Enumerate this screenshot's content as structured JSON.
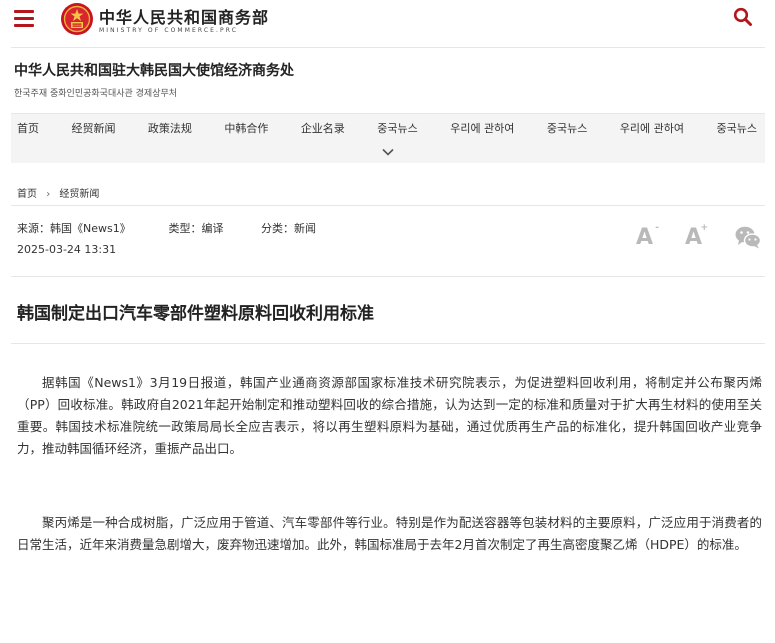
{
  "header": {
    "brand_cn": "中华人民共和国商务部",
    "brand_en": "MINISTRY OF COMMERCE.PRC",
    "accent_color": "#b3171c"
  },
  "org": {
    "name_cn": "中华人民共和国驻大韩民国大使馆经济商务处",
    "name_ko": "한국주재 중화인민공화국대사관 경제상무처"
  },
  "nav": {
    "items": [
      "首页",
      "经贸新闻",
      "政策法规",
      "中韩合作",
      "企业名录",
      "중국뉴스",
      "우리에 관하여",
      "중국뉴스",
      "우리에 관하여",
      "중국뉴스"
    ]
  },
  "breadcrumb": {
    "home": "首页",
    "separator": "›",
    "current": "经贸新闻"
  },
  "article": {
    "source": "来源：韩国《News1》",
    "type": "类型：编译",
    "category": "分类：新闻",
    "date": "2025-03-24 13:31",
    "title": "韩国制定出口汽车零部件塑料原料回收利用标准",
    "paragraphs": [
      "据韩国《News1》3月19日报道，韩国产业通商资源部国家标准技术研究院表示，为促进塑料回收利用，将制定并公布聚丙烯（PP）回收标准。韩政府自2021年起开始制定和推动塑料回收的综合措施，认为达到一定的标准和质量对于扩大再生材料的使用至关重要。韩国技术标准院统一政策局局长全应吉表示，将以再生塑料原料为基础，通过优质再生产品的标准化，提升韩国回收产业竞争力，推动韩国循环经济，重振产品出口。",
      "聚丙烯是一种合成树脂，广泛应用于管道、汽车零部件等行业。特别是作为配送容器等包装材料的主要原料，广泛应用于消费者的日常生活，近年来消费量急剧增大，废弃物迅速增加。此外，韩国标准局于去年2月首次制定了再生高密度聚乙烯（HDPE）的标准。"
    ]
  },
  "tools": {
    "font_letter": "A",
    "decrease_sign": "-",
    "increase_sign": "+",
    "icon_color": "#b9b9b9"
  }
}
